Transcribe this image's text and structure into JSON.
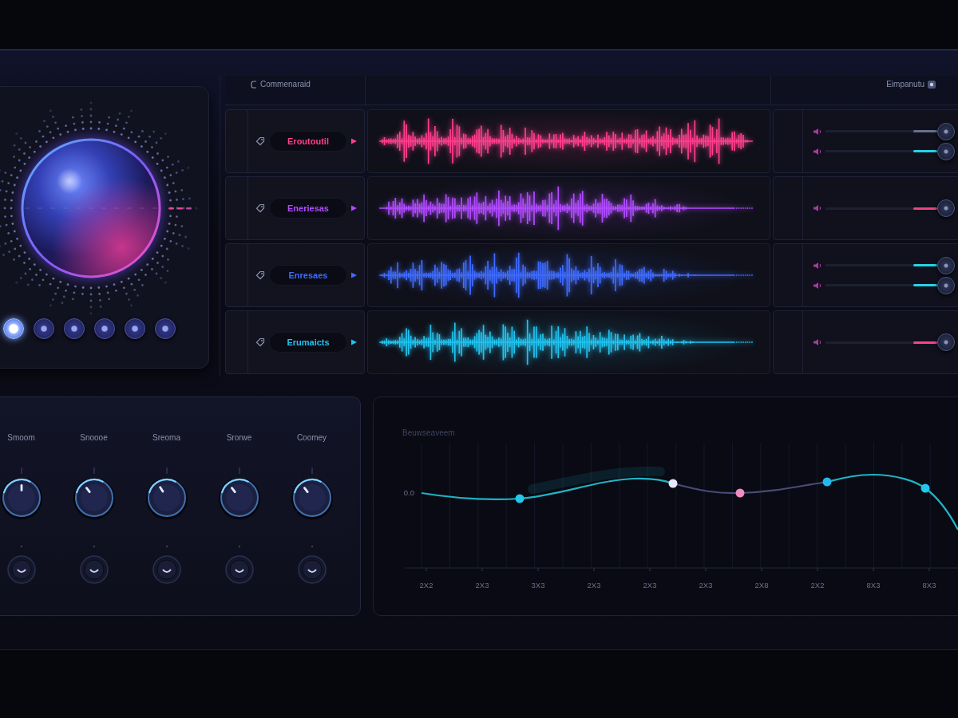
{
  "header": {
    "title": "Commenaraid",
    "right_title": "Eimpanutu"
  },
  "visualizer": {
    "modes": [
      {
        "selected": true
      },
      {
        "selected": false
      },
      {
        "selected": false
      },
      {
        "selected": false
      },
      {
        "selected": false
      },
      {
        "selected": false
      }
    ]
  },
  "tracks": [
    {
      "name": "Eroutoutil",
      "color": "#ff3f8e",
      "sliders": [
        {
          "color": "#66708e",
          "level": 1
        },
        {
          "color": "#27d3e6",
          "level": 1
        }
      ]
    },
    {
      "name": "Eneriesas",
      "color": "#b24cff",
      "sliders": [
        {
          "color": "#e8457e",
          "level": 1
        }
      ]
    },
    {
      "name": "Enresaes",
      "color": "#3f6cff",
      "sliders": [
        {
          "color": "#27d3e6",
          "level": 1
        },
        {
          "color": "#27d3e6",
          "level": 1
        }
      ]
    },
    {
      "name": "Erumaicts",
      "color": "#22c4f0",
      "sliders": [
        {
          "color": "#ff3f8e",
          "level": 1
        }
      ]
    }
  ],
  "knobs": [
    {
      "label": "Smoom",
      "level": 0.5
    },
    {
      "label": "Snoooe",
      "level": 0.36
    },
    {
      "label": "Sreoma",
      "level": 0.38
    },
    {
      "label": "Srorwe",
      "level": 0.36
    },
    {
      "label": "Coomey",
      "level": 0.36
    }
  ],
  "eq": {
    "title": "Beuwseaveem",
    "y_label": "0.0",
    "x_labels": [
      "2X2",
      "2X3",
      "3X3",
      "2X3",
      "2X3",
      "2X3",
      "2X8",
      "2X2",
      "8X3",
      "8X3"
    ],
    "points": [
      {
        "color": "#22c8ec"
      },
      {
        "color": "#e6e8ff"
      },
      {
        "color": "#f08cc0"
      },
      {
        "color": "#22b8ec"
      },
      {
        "color": "#22c8ec"
      }
    ]
  }
}
